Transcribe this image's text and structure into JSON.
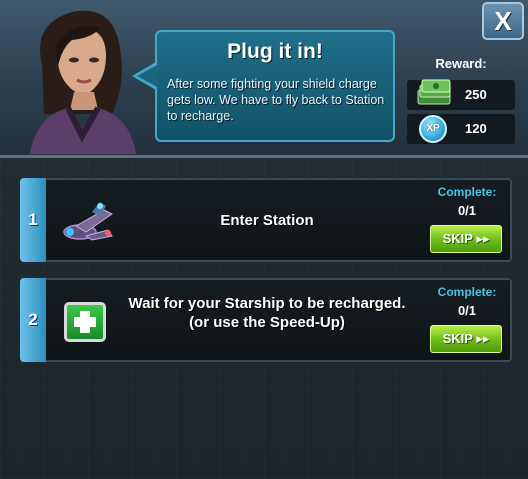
{
  "header": {
    "title": "Plug it in!",
    "description": "After some fighting your shield charge gets low. We have to fly back to Station to recharge.",
    "close_label": "X"
  },
  "reward": {
    "title": "Reward:",
    "cash_value": "250",
    "xp_label": "XP",
    "xp_value": "120"
  },
  "tasks": [
    {
      "number": "1",
      "text": "Enter Station",
      "complete_label": "Complete:",
      "progress": "0/1",
      "skip_label": "SKIP ▸▸",
      "icon": "starship-icon"
    },
    {
      "number": "2",
      "text_line1": "Wait for your Starship to be recharged.",
      "text_line2": "(or use the Speed-Up)",
      "complete_label": "Complete:",
      "progress": "0/1",
      "skip_label": "SKIP ▸▸",
      "icon": "medkit-icon"
    }
  ],
  "colors": {
    "accent": "#49c5e6",
    "skip_green": "#6cbb17",
    "bubble_blue": "#1f6f8a"
  }
}
